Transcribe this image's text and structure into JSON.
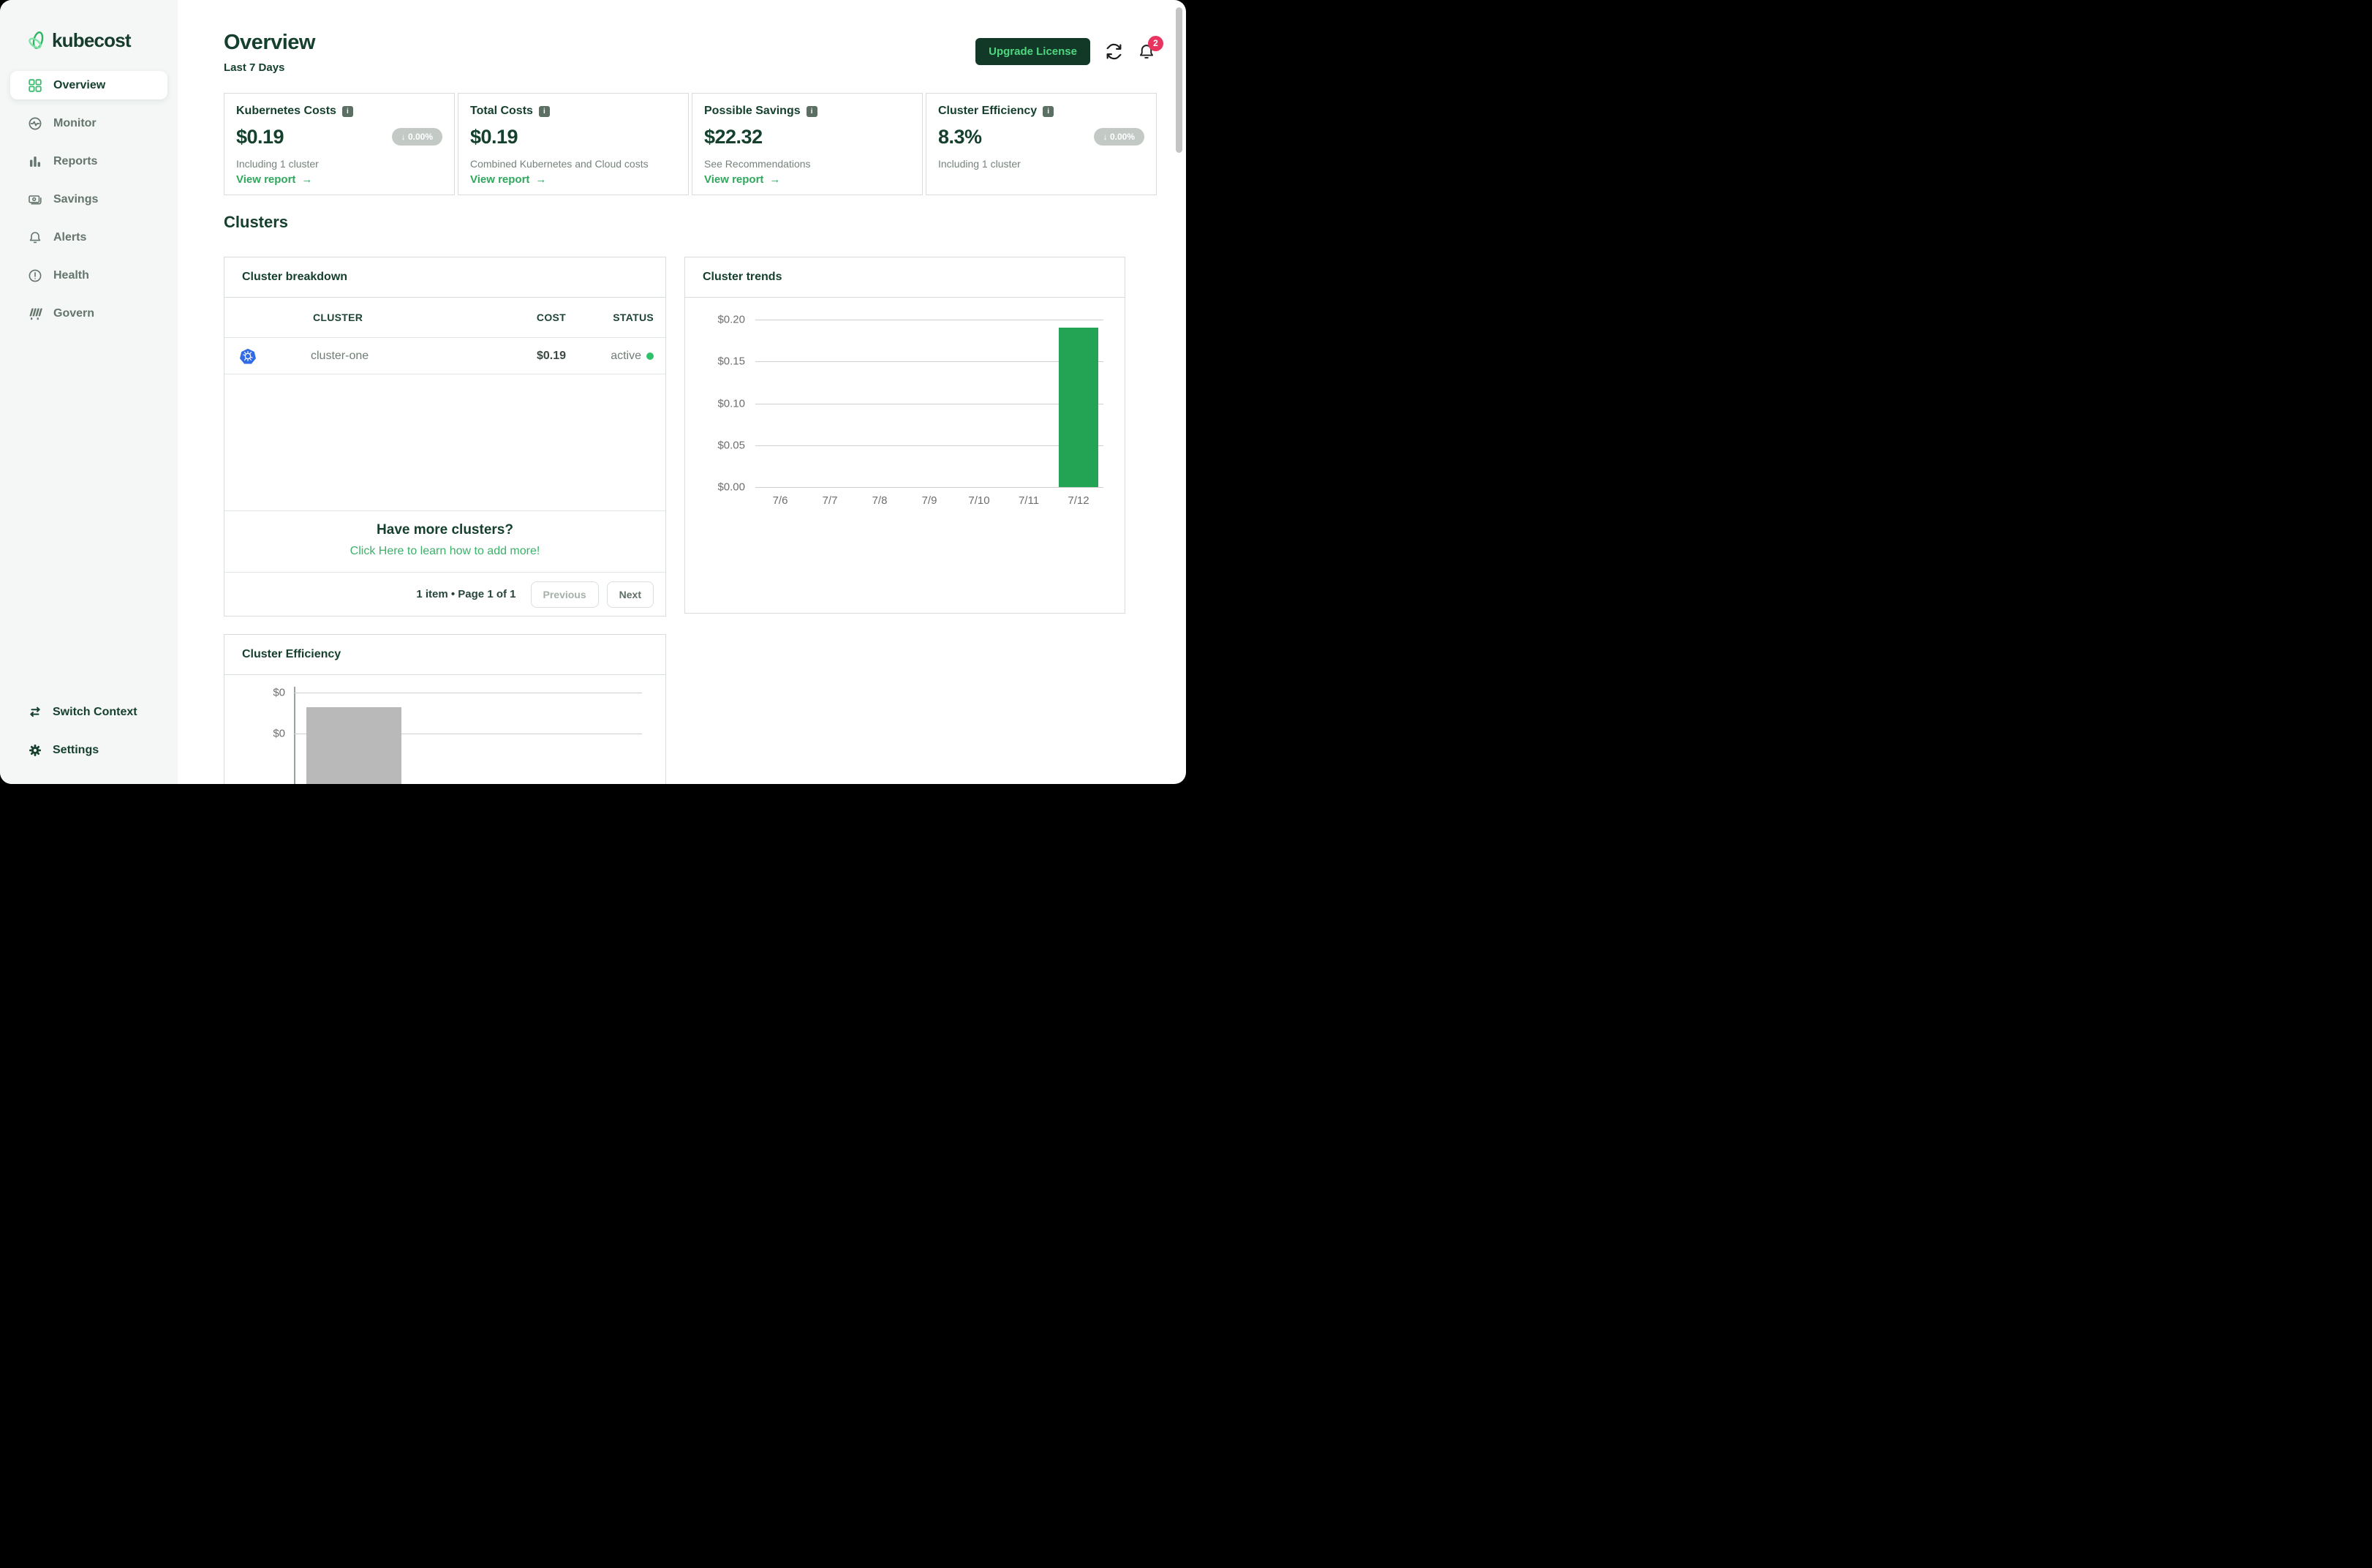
{
  "sidebar": {
    "logo_text": "kubecost",
    "items": [
      {
        "label": "Overview",
        "icon": "grid-icon",
        "active": true
      },
      {
        "label": "Monitor",
        "icon": "monitor-icon",
        "active": false
      },
      {
        "label": "Reports",
        "icon": "bar-chart-icon",
        "active": false
      },
      {
        "label": "Savings",
        "icon": "banknote-icon",
        "active": false
      },
      {
        "label": "Alerts",
        "icon": "bell-icon",
        "active": false
      },
      {
        "label": "Health",
        "icon": "health-icon",
        "active": false
      },
      {
        "label": "Govern",
        "icon": "govern-icon",
        "active": false
      }
    ],
    "footer_items": [
      {
        "label": "Switch Context",
        "icon": "swap-arrows-icon"
      },
      {
        "label": "Settings",
        "icon": "gear-icon"
      }
    ]
  },
  "header": {
    "title": "Overview",
    "subtitle": "Last 7 Days",
    "upgrade_button": "Upgrade License",
    "notification_count": "2"
  },
  "glyphs": {
    "down_arrow": "↓",
    "right_arrow": "→"
  },
  "metric_cards": [
    {
      "title": "Kubernetes Costs",
      "value": "$0.19",
      "delta": "0.00%",
      "delta_direction": "down",
      "note": "Including 1 cluster",
      "link": "View report"
    },
    {
      "title": "Total Costs",
      "value": "$0.19",
      "note": "Combined Kubernetes and Cloud costs",
      "link": "View report"
    },
    {
      "title": "Possible Savings",
      "value": "$22.32",
      "note": "See Recommendations",
      "link": "View report"
    },
    {
      "title": "Cluster Efficiency",
      "value": "8.3%",
      "delta": "0.00%",
      "delta_direction": "down",
      "note": "Including 1 cluster"
    }
  ],
  "clusters_section": {
    "heading": "Clusters",
    "breakdown": {
      "title": "Cluster breakdown",
      "columns": [
        "CLUSTER",
        "COST",
        "STATUS"
      ],
      "rows": [
        {
          "cluster": "cluster-one",
          "cost": "$0.19",
          "status": "active"
        }
      ],
      "more_title": "Have more clusters?",
      "more_link": "Click Here to learn how to add more!",
      "pagination": {
        "summary": "1 item • Page 1 of 1",
        "prev": "Previous",
        "next": "Next"
      }
    },
    "trends": {
      "title": "Cluster trends"
    },
    "efficiency": {
      "title": "Cluster Efficiency"
    }
  },
  "chart_data": [
    {
      "type": "bar",
      "title": "Cluster trends",
      "categories": [
        "7/6",
        "7/7",
        "7/8",
        "7/9",
        "7/10",
        "7/11",
        "7/12"
      ],
      "values": [
        0,
        0,
        0,
        0,
        0,
        0,
        0.19
      ],
      "ylim": [
        0,
        0.2
      ],
      "yticks": [
        "$0.20",
        "$0.15",
        "$0.10",
        "$0.05",
        "$0.00"
      ],
      "xlabel": "",
      "ylabel": "",
      "grid": "horizontal",
      "legend": "none",
      "bar_color": "#23a455"
    },
    {
      "type": "bar",
      "title": "Cluster Efficiency",
      "categories": [
        ""
      ],
      "values": [
        null
      ],
      "yticks": [
        "$0",
        "$0"
      ],
      "bar_color": "#b9b9b9",
      "note": "Chart cut off at bottom edge of viewport; one gray bar visible extending below the fold"
    }
  ],
  "colors": {
    "dark_green": "#16402e",
    "accent_green": "#2fa75c",
    "button_bg": "#123828",
    "button_text": "#4fd77f",
    "badge_red": "#e8355f",
    "pill_gray": "#c3cac6",
    "kubernetes_blue": "#326ce5",
    "bar_green": "#23a455",
    "bar_gray": "#b9b9b9",
    "status_green": "#2fc16a"
  }
}
